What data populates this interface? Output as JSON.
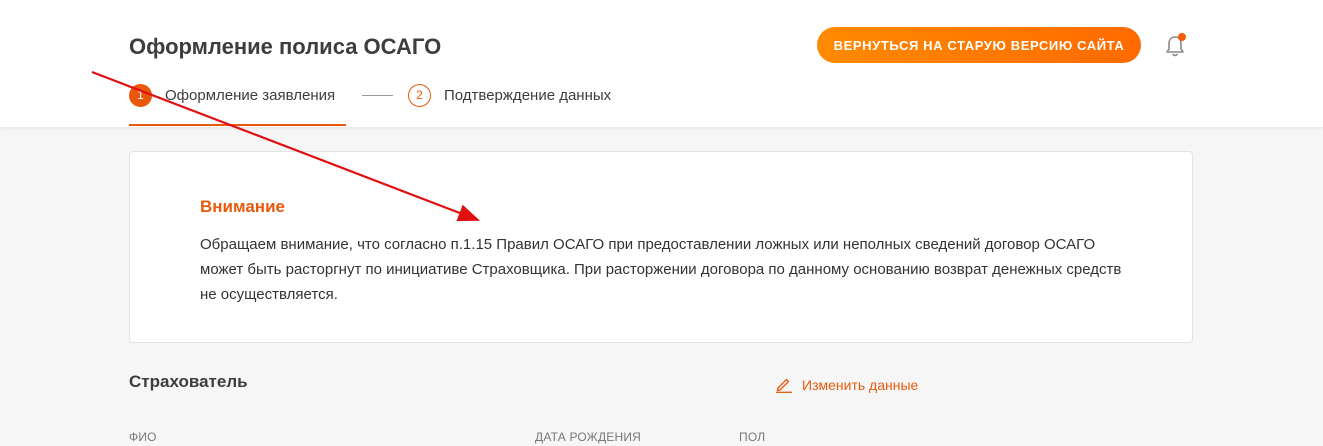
{
  "header": {
    "title": "Оформление полиса ОСАГО",
    "old_version_button": "ВЕРНУТЬСЯ НА СТАРУЮ ВЕРСИЮ САЙТА"
  },
  "steps": [
    {
      "number": "1",
      "label": "Оформление заявления",
      "active": true
    },
    {
      "number": "2",
      "label": "Подтверждение данных",
      "active": false
    }
  ],
  "notice": {
    "title": "Внимание",
    "text": "Обращаем внимание, что согласно п.1.15 Правил ОСАГО при предоставлении ложных или неполных сведений договор ОСАГО может быть расторгнут по инициативе Страховщика. При расторжении договора по данному основанию возврат денежных средств не осуществляется."
  },
  "insurer_section": {
    "title": "Страхователь",
    "edit_link": "Изменить данные",
    "columns": [
      "ФИО",
      "ДАТА РОЖДЕНИЯ",
      "ПОЛ"
    ]
  },
  "colors": {
    "accent": "#e8590c",
    "button_gradient_start": "#ff8a00",
    "button_gradient_end": "#ff6a00",
    "annotation_arrow": "#e01010"
  },
  "icons": {
    "notification": "bell-icon",
    "edit": "pencil-icon"
  }
}
